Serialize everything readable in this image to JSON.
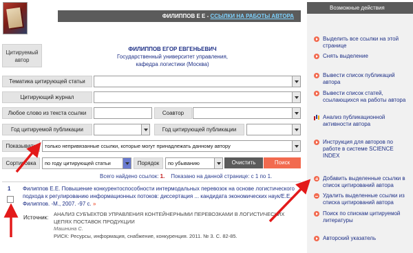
{
  "header": {
    "author_short": "ФИЛИППОВ Е Е",
    "separator": " - ",
    "link_text": "ССЫЛКИ НА РАБОТЫ АВТОРА"
  },
  "cited_author": {
    "label_line1": "Цитируемый",
    "label_line2": "автор",
    "name": "ФИЛИППОВ ЕГОР ЕВГЕНЬЕВИЧ",
    "org_line1": "Государственный университет управления,",
    "org_line2": "кафедра логистики (Москва)"
  },
  "filters": {
    "topic_label": "Тематика цитирующей статьи",
    "topic_value": "",
    "journal_label": "Цитирующий журнал",
    "journal_value": "",
    "anyword_label": "Любое слово из текста ссылки",
    "anyword_value": "",
    "coauthor_label": "Соавтор",
    "coauthor_value": "",
    "cited_year_label": "Год цитируемой публикации",
    "cited_year_value": "",
    "citing_year_label": "Год цитирующей публикации",
    "citing_year_value": "",
    "show_label": "Показывать",
    "show_value": "только непривязанные ссылки, которые могут принадлежать данному автору",
    "sort_label": "Сортировка",
    "sort_value": "по году цитирующей статьи",
    "order_label": "Порядок",
    "order_value": "по убыванию",
    "clear_button": "Очистить",
    "search_button": "Поиск"
  },
  "results": {
    "found_prefix": "Всего найдено ссылок: ",
    "found_count": "1.",
    "shown_text": "Показано на данной странице: с 1 по 1."
  },
  "record": {
    "number": "1",
    "citation": "Филиппов Е.Е. Повышение конкурентоспособности интермодальных перевозок на основе логистического подхода к регулированию информационных потоков: диссертация ... кандидата экономических наук/Е.Е. Филиппов. -М., 2007. -97 с.",
    "more_arrow": "»",
    "source_label": "Источник:",
    "source_title": "АНАЛИЗ СУБЪЕКТОВ УПРАВЛЕНИЯ КОНТЕЙНЕРНЫМИ ПЕРЕВОЗКАМИ В ЛОГИСТИЧЕСКИХ ЦЕПЯХ ПОСТАВОК ПРОДУКЦИИ",
    "source_author": "Машнина С.",
    "source_pub": "РИСК: Ресурсы, информация, снабжение, конкуренция. 2011. № 3. С. 82-85."
  },
  "actions_panel": {
    "title": "Возможные действия",
    "items": [
      {
        "label": "Выделить все ссылки на этой странице",
        "icon": "arrow-bullet-icon"
      },
      {
        "label": "Снять выделение",
        "icon": "arrow-bullet-icon"
      },
      {
        "label": "Вывести список публикаций автора",
        "icon": "arrow-bullet-icon"
      },
      {
        "label": "Вывести список статей, ссылающихся на работы автора",
        "icon": "arrow-bullet-icon"
      },
      {
        "label": "Анализ публикационной активности автора",
        "icon": "bar-chart-icon"
      },
      {
        "label": "Инструкция для авторов по работе в системе SCIENCE INDEX",
        "icon": "arrow-bullet-icon"
      },
      {
        "label": "Добавить выделенные ссылки в список цитирований автора",
        "icon": "plus-icon"
      },
      {
        "label": "Удалить выделенные ссылки из списка цитирований автора",
        "icon": "minus-icon"
      },
      {
        "label": "Поиск по спискам цитируемой литературы",
        "icon": "arrow-bullet-icon"
      },
      {
        "label": "Авторский указатель",
        "icon": "arrow-bullet-icon"
      }
    ]
  },
  "colors": {
    "accent_red": "#f26a4f",
    "link_blue": "#1d2f86",
    "header_gray": "#5b5b5b",
    "annotation_red": "#e31a1a"
  }
}
